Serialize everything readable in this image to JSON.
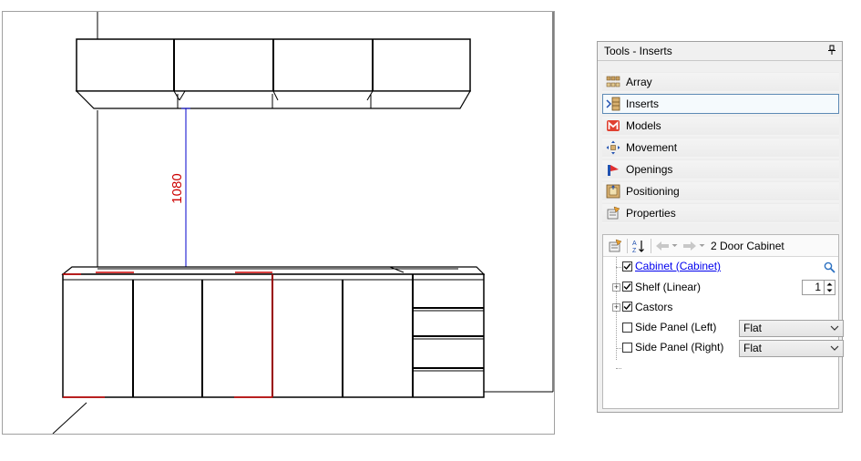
{
  "viewport": {
    "dimension_label": "1080",
    "colors": {
      "dimension": "#0000cc",
      "dimension_text": "#cc0000",
      "highlight": "#cc0000"
    }
  },
  "panel": {
    "title": "Tools - Inserts",
    "pin_icon": "pin-icon",
    "tools": [
      {
        "label": "Array",
        "icon": "array-icon",
        "selected": false
      },
      {
        "label": "Inserts",
        "icon": "inserts-icon",
        "selected": true
      },
      {
        "label": "Models",
        "icon": "models-icon",
        "selected": false
      },
      {
        "label": "Movement",
        "icon": "movement-icon",
        "selected": false
      },
      {
        "label": "Openings",
        "icon": "openings-icon",
        "selected": false
      },
      {
        "label": "Positioning",
        "icon": "positioning-icon",
        "selected": false
      },
      {
        "label": "Properties",
        "icon": "properties-icon",
        "selected": false
      }
    ],
    "inserts": {
      "toolbar_title": "2 Door Cabinet",
      "rows": {
        "cabinet": {
          "label": "Cabinet (Cabinet)",
          "checked": true
        },
        "shelf": {
          "label": "Shelf (Linear)",
          "checked": true,
          "value": "1"
        },
        "castors": {
          "label": "Castors",
          "checked": true
        },
        "side_left": {
          "label": "Side Panel (Left)",
          "checked": false,
          "option": "Flat"
        },
        "side_right": {
          "label": "Side Panel (Right)",
          "checked": false,
          "option": "Flat"
        }
      }
    }
  }
}
